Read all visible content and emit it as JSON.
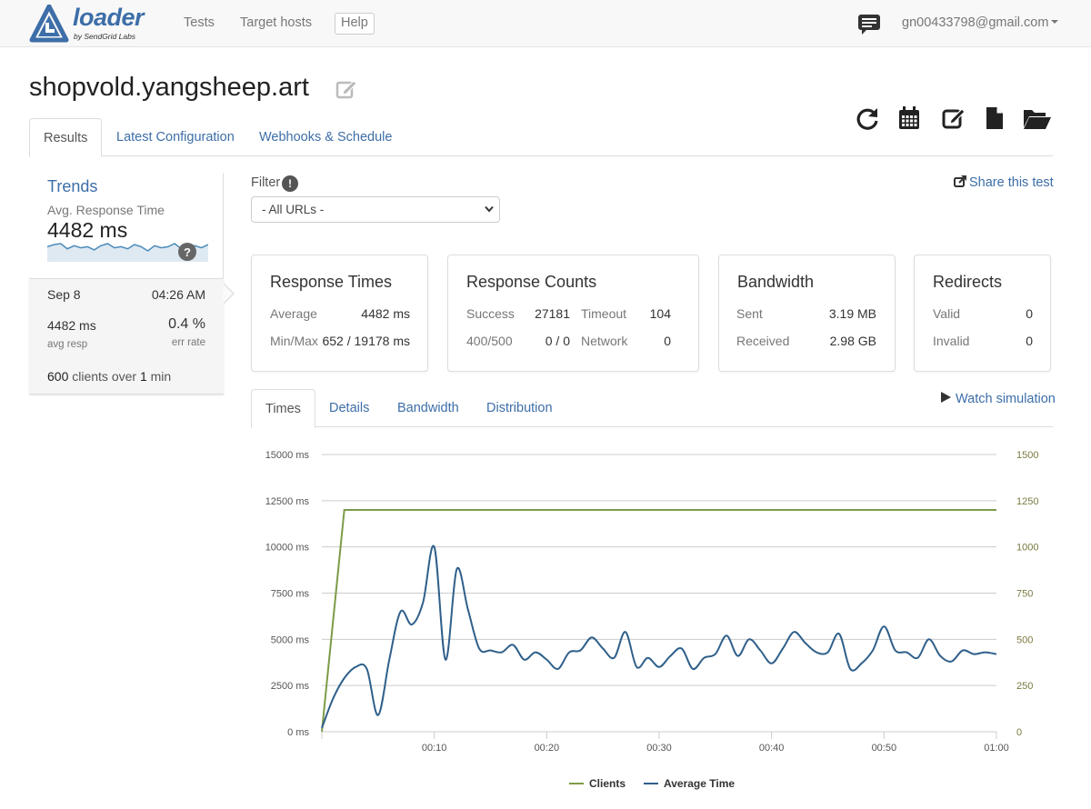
{
  "navbar": {
    "brand": "loader",
    "brand_sub": "by SendGrid Labs",
    "links": [
      "Tests",
      "Target hosts"
    ],
    "help": "Help",
    "user_email": "gn00433798@gmail.com"
  },
  "page": {
    "title": "shopvold.yangsheep.art",
    "tabs": [
      "Results",
      "Latest Configuration",
      "Webhooks & Schedule"
    ],
    "active_tab": "Results"
  },
  "toolbar": {
    "icons": [
      "refresh-icon",
      "calendar-icon",
      "edit-icon",
      "document-icon",
      "folder-open-icon"
    ]
  },
  "trends": {
    "title": "Trends",
    "subtitle": "Avg. Response Time",
    "value": "4482 ms",
    "sparkline": [
      4.6,
      4.8,
      4.9,
      4.4,
      4.7,
      4.5,
      4.6,
      4.3,
      4.7,
      4.9,
      4.5,
      4.6,
      4.4,
      4.8,
      4.6,
      4.2,
      4.7,
      4.5,
      4.6,
      4.9,
      4.4,
      4.6,
      4.7,
      4.5,
      4.8
    ],
    "card": {
      "date": "Sep 8",
      "time": "04:26 AM",
      "avg_resp": "4482 ms",
      "avg_resp_label": "avg resp",
      "err_rate": "0.4 %",
      "err_rate_label": "err rate",
      "clients_count": "600",
      "clients_mid": "clients over",
      "duration_num": "1",
      "duration_unit": "min"
    }
  },
  "filter": {
    "label": "Filter",
    "info": "!",
    "selected": "- All URLs -"
  },
  "share": "Share this test",
  "stats": {
    "response_times": {
      "title": "Response Times",
      "average_label": "Average",
      "average": "4482 ms",
      "minmax_label": "Min/Max",
      "minmax": "652 / 19178 ms"
    },
    "response_counts": {
      "title": "Response Counts",
      "success_label": "Success",
      "success": "27181",
      "timeout_label": "Timeout",
      "timeout": "104",
      "e400_label": "400/500",
      "e400": "0 / 0",
      "network_label": "Network",
      "network": "0"
    },
    "bandwidth": {
      "title": "Bandwidth",
      "sent_label": "Sent",
      "sent": "3.19 MB",
      "received_label": "Received",
      "received": "2.98 GB"
    },
    "redirects": {
      "title": "Redirects",
      "valid_label": "Valid",
      "valid": "0",
      "invalid_label": "Invalid",
      "invalid": "0"
    }
  },
  "chart_tabs": [
    "Times",
    "Details",
    "Bandwidth",
    "Distribution"
  ],
  "active_chart_tab": "Times",
  "watch": "Watch simulation",
  "colors": {
    "link": "#3d6ea8",
    "clients": "#7d9b48",
    "avg_time": "#2f5f8a"
  },
  "chart_data": {
    "type": "line",
    "title": "",
    "y_left_ticks": [
      "0 ms",
      "2500 ms",
      "5000 ms",
      "7500 ms",
      "10000 ms",
      "12500 ms",
      "15000 ms"
    ],
    "y_right_ticks": [
      "0",
      "250",
      "500",
      "750",
      "1000",
      "1250",
      "1500"
    ],
    "x_ticks": [
      "00:10",
      "00:20",
      "00:30",
      "00:40",
      "00:50",
      "01:00"
    ],
    "ylim_left": [
      0,
      15000
    ],
    "ylim_right": [
      0,
      1500
    ],
    "xlim_seconds": [
      0,
      60
    ],
    "legend_position": "bottom-center",
    "series": [
      {
        "name": "Clients",
        "axis": "right",
        "x": [
          0,
          2,
          60
        ],
        "values": [
          0,
          1200,
          1200
        ]
      },
      {
        "name": "Average Time",
        "axis": "left",
        "x": [
          0,
          1,
          2,
          3,
          4,
          5,
          6,
          7,
          8,
          9,
          10,
          11,
          12,
          13,
          14,
          15,
          16,
          17,
          18,
          19,
          20,
          21,
          22,
          23,
          24,
          25,
          26,
          27,
          28,
          29,
          30,
          31,
          32,
          33,
          34,
          35,
          36,
          37,
          38,
          39,
          40,
          41,
          42,
          43,
          44,
          45,
          46,
          47,
          48,
          49,
          50,
          51,
          52,
          53,
          54,
          55,
          56,
          57,
          58,
          59,
          60
        ],
        "values": [
          200,
          1800,
          2900,
          3500,
          3400,
          900,
          3900,
          6500,
          5800,
          7000,
          10000,
          3900,
          8800,
          6600,
          4500,
          4400,
          4300,
          4700,
          3900,
          4300,
          3900,
          3400,
          4300,
          4400,
          5100,
          4500,
          4000,
          5400,
          3500,
          4000,
          3500,
          4100,
          4500,
          3400,
          4000,
          4200,
          5200,
          4100,
          5000,
          4400,
          3700,
          4500,
          5400,
          4800,
          4300,
          4300,
          5300,
          3400,
          3700,
          4400,
          5700,
          4400,
          4300,
          4000,
          5000,
          4100,
          3800,
          4400,
          4200,
          4300,
          4200
        ]
      }
    ]
  }
}
